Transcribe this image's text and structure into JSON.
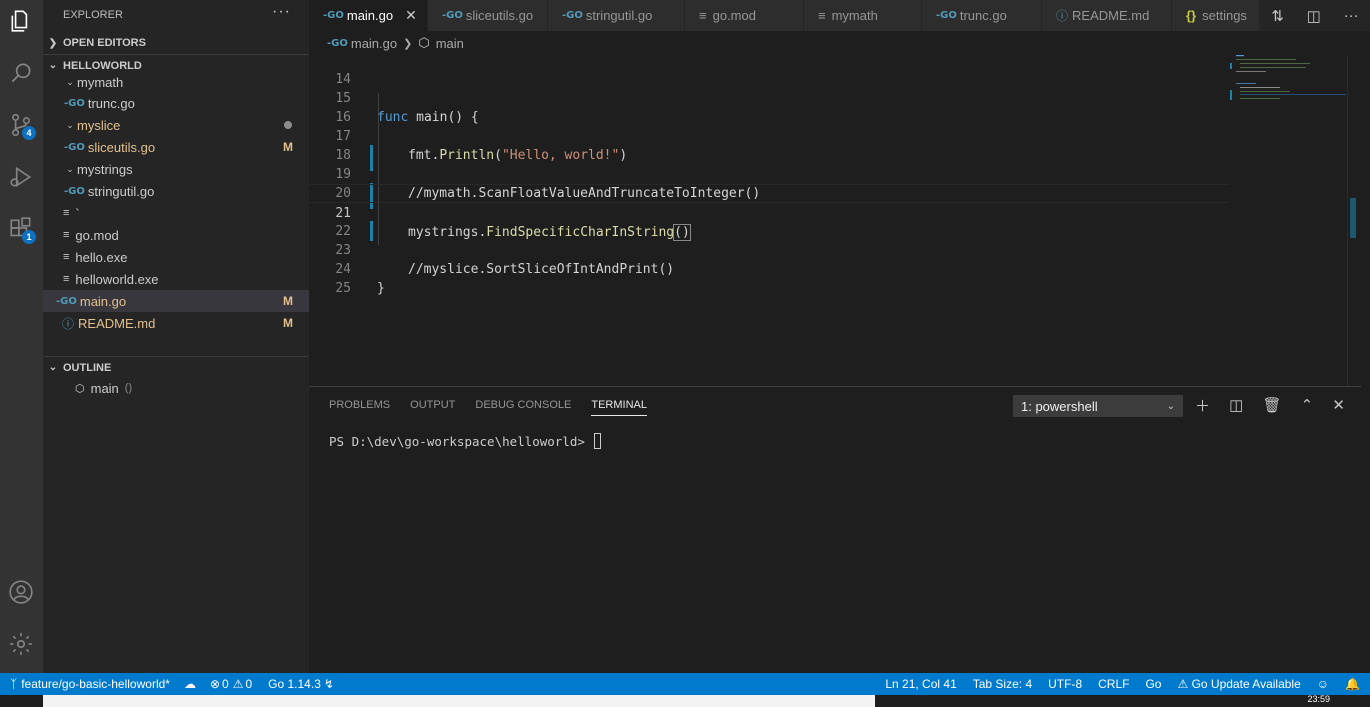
{
  "sidebar": {
    "title": "EXPLORER",
    "open_editors": "OPEN EDITORS",
    "workspace": "HELLOWORLD",
    "outline": "OUTLINE",
    "tree": [
      {
        "label": "mymath",
        "kind": "folder",
        "status": ""
      },
      {
        "label": "trunc.go",
        "kind": "go",
        "status": ""
      },
      {
        "label": "myslice",
        "kind": "folder",
        "status": "dot"
      },
      {
        "label": "sliceutils.go",
        "kind": "go",
        "status": "M"
      },
      {
        "label": "mystrings",
        "kind": "folder",
        "status": ""
      },
      {
        "label": "stringutil.go",
        "kind": "go",
        "status": ""
      },
      {
        "label": "`",
        "kind": "file",
        "status": ""
      },
      {
        "label": "go.mod",
        "kind": "file",
        "status": ""
      },
      {
        "label": "hello.exe",
        "kind": "file",
        "status": ""
      },
      {
        "label": "helloworld.exe",
        "kind": "file",
        "status": ""
      },
      {
        "label": "main.go",
        "kind": "go",
        "status": "M"
      },
      {
        "label": "README.md",
        "kind": "info",
        "status": "M"
      }
    ],
    "outline_item": "main",
    "outline_suffix": "()"
  },
  "activity": {
    "scm_badge": "4",
    "extensions_badge": "1"
  },
  "tabs": [
    {
      "label": "main.go",
      "icon": "go",
      "active": true
    },
    {
      "label": "sliceutils.go",
      "icon": "go"
    },
    {
      "label": "stringutil.go",
      "icon": "go"
    },
    {
      "label": "go.mod",
      "icon": "lines"
    },
    {
      "label": "mymath",
      "icon": "lines"
    },
    {
      "label": "trunc.go",
      "icon": "go"
    },
    {
      "label": "README.md",
      "icon": "info"
    },
    {
      "label": "settings",
      "icon": "braces"
    }
  ],
  "breadcrumb": {
    "file": "main.go",
    "symbol": "main"
  },
  "editor": {
    "lines": [
      {
        "n": "14",
        "code": ""
      },
      {
        "n": "15",
        "code": "func main() {"
      },
      {
        "n": "16",
        "code": ""
      },
      {
        "n": "17",
        "code": "    fmt.Println(\"Hello, world!\")"
      },
      {
        "n": "18",
        "code": ""
      },
      {
        "n": "19",
        "code": "    //mymath.ScanFloatValueAndTruncateToInteger()"
      },
      {
        "n": "20",
        "code": ""
      },
      {
        "n": "21",
        "code": "    mystrings.FindSpecificCharInString()"
      },
      {
        "n": "22",
        "code": ""
      },
      {
        "n": "23",
        "code": "    //myslice.SortSliceOfIntAndPrint()"
      },
      {
        "n": "24",
        "code": "}"
      },
      {
        "n": "25",
        "code": ""
      }
    ],
    "line15": {
      "kw": "func",
      "rest": " main() {"
    },
    "line17": {
      "pkg": "fmt.",
      "fn": "Println",
      "open": "(",
      "str": "\"Hello, world!\"",
      "close": ")"
    },
    "line19": "//mymath.ScanFloatValueAndTruncateToInteger()",
    "line21": {
      "pkg": "mystrings.",
      "fn": "FindSpecificCharInString",
      "parens": "()"
    },
    "line23": "//myslice.SortSliceOfIntAndPrint()",
    "line24": "}"
  },
  "panel": {
    "tabs": [
      "PROBLEMS",
      "OUTPUT",
      "DEBUG CONSOLE",
      "TERMINAL"
    ],
    "terminal_select": "1: powershell",
    "prompt": "PS D:\\dev\\go-workspace\\helloworld> "
  },
  "status": {
    "branch": "feature/go-basic-helloworld*",
    "errors": "0",
    "warnings": "0",
    "go_version": "Go 1.14.3",
    "position": "Ln 21, Col 41",
    "tab_size": "Tab Size: 4",
    "encoding": "UTF-8",
    "eol": "CRLF",
    "language": "Go",
    "update": "Go Update Available"
  },
  "taskbar": {
    "time": "23:59"
  },
  "colors": {
    "statusbar": "#007acc",
    "activity": "#333333",
    "sidebar": "#252526",
    "editor": "#1e1e1e",
    "modified": "#e2c08d"
  }
}
